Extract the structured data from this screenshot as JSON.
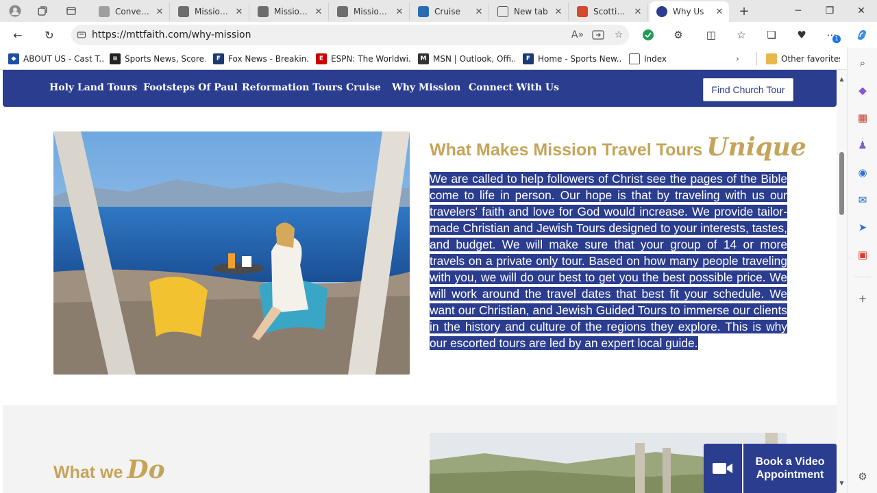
{
  "browser": {
    "tabs": [
      {
        "title": "Conventions",
        "favicon_color": "#9e9e9e",
        "active": false
      },
      {
        "title": "Mission Tra",
        "favicon_color": "#6d6d6d",
        "active": false
      },
      {
        "title": "Mission Tra",
        "favicon_color": "#6d6d6d",
        "active": false
      },
      {
        "title": "Mission Tra",
        "favicon_color": "#6d6d6d",
        "active": false
      },
      {
        "title": "Cruise",
        "favicon_color": "#2b6cb0",
        "active": false
      },
      {
        "title": "New tab",
        "favicon_color": "#555555",
        "active": false
      },
      {
        "title": "Scottie Sc",
        "favicon_color": "#d34a2c",
        "active": false
      },
      {
        "title": "Why Us",
        "favicon_color": "#2b3d8f",
        "active": true
      }
    ],
    "new_tab_symbol": "+",
    "url": "https://mttfaith.com/why-mission",
    "favorites": [
      {
        "label": "ABOUT US - Cast T...",
        "color": "#1e4fa0"
      },
      {
        "label": "Sports News, Score...",
        "color": "#222222"
      },
      {
        "label": "Fox News - Breakin...",
        "color": "#1b3a73"
      },
      {
        "label": "ESPN: The Worldwi...",
        "color": "#cc0000"
      },
      {
        "label": "MSN | Outlook, Offi...",
        "color": "#333333"
      },
      {
        "label": "Home - Sports New...",
        "color": "#1b3a73"
      },
      {
        "label": "Index",
        "color": "#555555"
      }
    ],
    "other_favorites": "Other favorites",
    "settings_badge": "1"
  },
  "site": {
    "nav": [
      "Holy Land Tours",
      "Footsteps Of Paul",
      "Reformation Tours",
      "Cruise",
      "Why Mission",
      "Connect With Us"
    ],
    "cta_label": "Find Church Tour",
    "headline": "What Makes Mission Travel Tours",
    "headline_script": "Unique",
    "body": "We are called to help followers of Christ see the pages of the Bible come to life in person. Our hope is that by traveling with us our travelers' faith and love for God would increase. We provide tailor-made Christian and Jewish Tours designed to your interests, tastes, and budget. We will make sure that your group of 14 or more travels on a private only tour. Based on how many people traveling with you, we will do our best to get you the best possible price. We will work around the travel dates that best fit your schedule. We want our Christian, and Jewish Guided Tours to immerse our clients in the history and culture of the regions they explore. This is why our escorted tours are led by an expert local guide.",
    "section2_title": "What we",
    "section2_script": "Do",
    "video_button": "Book a Video Appointment"
  },
  "colors": {
    "brand_blue": "#2b3d8f",
    "gold": "#c5a459"
  }
}
